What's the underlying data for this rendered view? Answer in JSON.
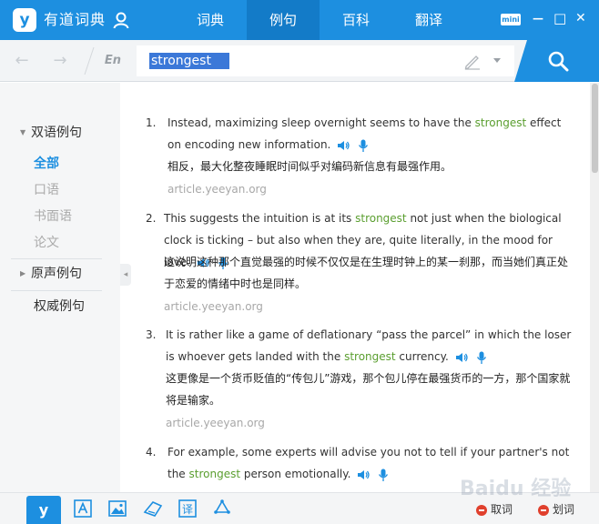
{
  "app": {
    "title": "有道词典",
    "logo_glyph": "y"
  },
  "nav": {
    "tabs": [
      {
        "label": "词典",
        "active": false
      },
      {
        "label": "例句",
        "active": true
      },
      {
        "label": "百科",
        "active": false
      },
      {
        "label": "翻译",
        "active": false
      }
    ],
    "mini_label": "mini",
    "minimize": "—",
    "maximize": "□",
    "close": "✕"
  },
  "search": {
    "lang": "En",
    "query": "strongest",
    "back": "←",
    "forward": "→"
  },
  "sidebar": {
    "sections": [
      {
        "label": "双语例句",
        "expanded": true,
        "items": [
          {
            "label": "全部",
            "active": true
          },
          {
            "label": "口语",
            "active": false
          },
          {
            "label": "书面语",
            "active": false
          },
          {
            "label": "论文",
            "active": false
          }
        ]
      },
      {
        "label": "原声例句",
        "expanded": false
      },
      {
        "label": "权威例句"
      }
    ],
    "collapse_glyph": "◂"
  },
  "examples": [
    {
      "num": "1.",
      "en_before": "Instead, maximizing sleep overnight seems to have the ",
      "highlight": "strongest",
      "en_after": " effect on encoding new information.",
      "zh": "相反，最大化整夜睡眠时间似乎对编码新信息有最强作用。",
      "source": "article.yeeyan.org"
    },
    {
      "num": "2.",
      "en_before": "This suggests the intuition is at its ",
      "highlight": "strongest",
      "en_after": " not just when the biological clock is ticking – but also when they are, quite literally, in the mood for love.",
      "zh": "这说明这种那个直觉最强的时候不仅仅是在生理时钟上的某一刹那，而当她们真正处于恋爱的情绪中时也是同样。",
      "source": "article.yeeyan.org"
    },
    {
      "num": "3.",
      "en_before": "It is rather like a game of deflationary “pass the parcel” in which the loser is whoever gets landed with the ",
      "highlight": "strongest",
      "en_after": " currency.",
      "zh": "这更像是一个货币贬值的“传包儿”游戏，那个包儿停在最强货币的一方，那个国家就将是输家。",
      "source": "article.yeeyan.org"
    },
    {
      "num": "4.",
      "en_before": "For example, some experts will advise you not to tell if your partner's not the ",
      "highlight": "strongest",
      "en_after": " person emotionally.",
      "zh": "",
      "source": ""
    }
  ],
  "bottom": {
    "logo_glyph": "y",
    "actions": [
      {
        "label": "取词"
      },
      {
        "label": "划词"
      }
    ],
    "watermark": "Baidu 经验"
  },
  "colors": {
    "brand": "#1d8fe0",
    "highlight": "#5a9e2f",
    "active_tab": "#137bc8",
    "speaker": "#1d8fe0",
    "action_dot": "#e0402d"
  },
  "icons": {
    "user": "user-icon",
    "pen": "pen-icon",
    "search": "search-icon",
    "speaker": "speaker-icon",
    "mic": "mic-icon",
    "bottom": [
      "youdao-logo-icon",
      "text-capture-icon",
      "image-icon",
      "wordbook-icon",
      "translate-icon",
      "recycle-icon"
    ]
  }
}
